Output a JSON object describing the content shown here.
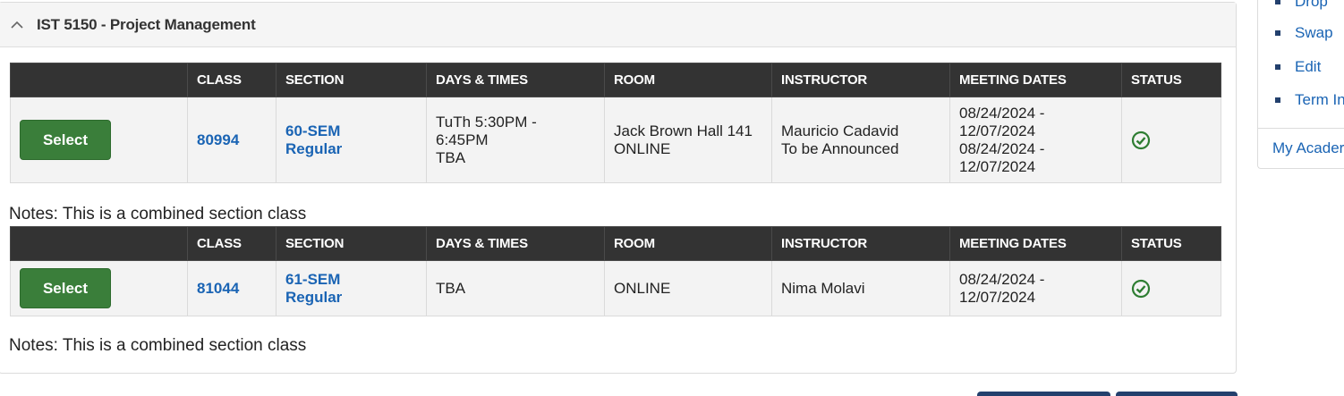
{
  "course": {
    "title": "IST 5150 - Project Management",
    "collapse_icon": "chevron-up-icon"
  },
  "table_headers": [
    "",
    "CLASS",
    "SECTION",
    "DAYS & TIMES",
    "ROOM",
    "INSTRUCTOR",
    "MEETING DATES",
    "STATUS"
  ],
  "classes": [
    {
      "select_label": "Select",
      "class_number": "80994",
      "section_line1": "60-SEM",
      "section_line2": "Regular",
      "days_times_line1": "TuTh 5:30PM -",
      "days_times_line2": "6:45PM",
      "days_times_line3": "TBA",
      "room_line1": "Jack Brown Hall 141",
      "room_line2": "ONLINE",
      "instructor_line1": "Mauricio Cadavid",
      "instructor_line2": "To be Announced",
      "dates_line1": "08/24/2024 -",
      "dates_line2": "12/07/2024",
      "dates_line3": "08/24/2024 -",
      "dates_line4": "12/07/2024",
      "status_icon": "open-check-icon",
      "notes": "Notes: This is a combined section class"
    },
    {
      "select_label": "Select",
      "class_number": "81044",
      "section_line1": "61-SEM",
      "section_line2": "Regular",
      "days_times_line1": "TBA",
      "room_line1": "ONLINE",
      "instructor_line1": "Nima Molavi",
      "dates_line1": "08/24/2024 -",
      "dates_line2": "12/07/2024",
      "status_icon": "open-check-icon",
      "notes": "Notes: This is a combined section class"
    }
  ],
  "sidebar": {
    "items": [
      {
        "label": "Drop"
      },
      {
        "label": "Swap"
      },
      {
        "label": "Edit"
      },
      {
        "label": "Term In"
      }
    ],
    "bottom_link": "My Acader"
  },
  "colors": {
    "header_bg": "#333333",
    "select_button": "#3a7e3a",
    "link": "#1a64b4",
    "status_green": "#2e7d32"
  }
}
